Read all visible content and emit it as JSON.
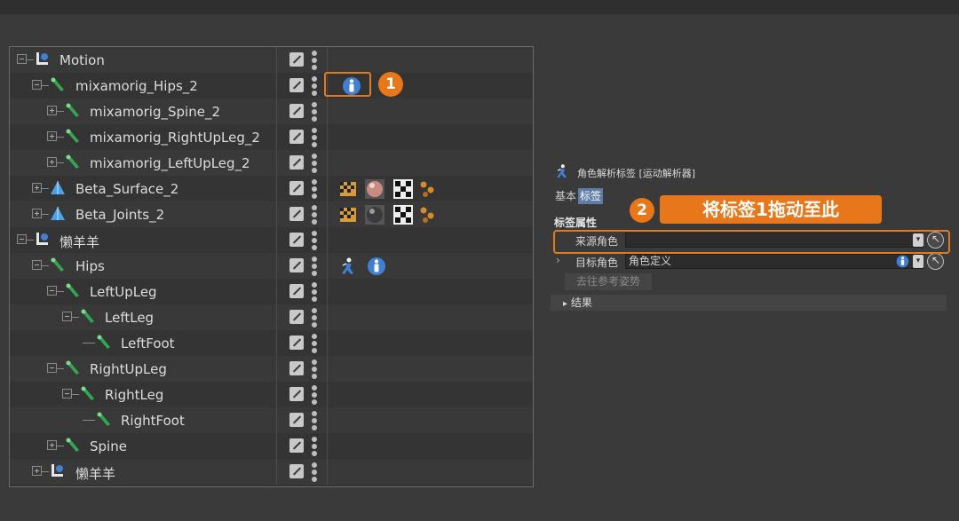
{
  "object_manager": {
    "rows": [
      {
        "label": "Motion",
        "kind": "null-object"
      },
      {
        "label": "mixamorig_Hips_2",
        "kind": "joint"
      },
      {
        "label": "mixamorig_Spine_2",
        "kind": "joint"
      },
      {
        "label": "mixamorig_RightUpLeg_2",
        "kind": "joint"
      },
      {
        "label": "mixamorig_LeftUpLeg_2",
        "kind": "joint"
      },
      {
        "label": "Beta_Surface_2",
        "kind": "mesh"
      },
      {
        "label": "Beta_Joints_2",
        "kind": "mesh"
      },
      {
        "label": "懒羊羊",
        "kind": "null-object"
      },
      {
        "label": "Hips",
        "kind": "joint"
      },
      {
        "label": "LeftUpLeg",
        "kind": "joint"
      },
      {
        "label": "LeftLeg",
        "kind": "joint"
      },
      {
        "label": "LeftFoot",
        "kind": "joint"
      },
      {
        "label": "RightUpLeg",
        "kind": "joint"
      },
      {
        "label": "RightLeg",
        "kind": "joint"
      },
      {
        "label": "RightFoot",
        "kind": "joint"
      },
      {
        "label": "Spine",
        "kind": "joint"
      },
      {
        "label": "懒羊羊",
        "kind": "null-object"
      }
    ]
  },
  "callouts": {
    "one": "1",
    "two": "2",
    "instruction": "将标签1拖动至此"
  },
  "attributes": {
    "title": "角色解析标签 [运动解析器]",
    "tabs": [
      "基本",
      "标签"
    ],
    "active_tab": "标签",
    "section": "标签属性",
    "source_label": "来源角色",
    "source_value": "",
    "target_label": "目标角色",
    "target_value": "角色定义",
    "goto_button": "去往参考姿势",
    "results_label": "结果",
    "expand_arrow": "›",
    "results_arrow": "▸"
  },
  "colors": {
    "accent": "#e8761a",
    "tab_active": "#5d7da8",
    "joint_green": "#2fa84f",
    "character_blue": "#3f7fd6"
  }
}
